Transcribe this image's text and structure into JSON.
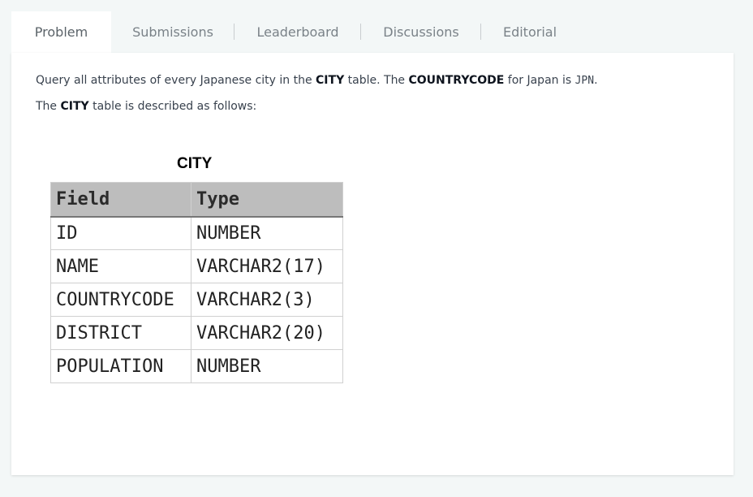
{
  "tabs": [
    {
      "label": "Problem",
      "active": true
    },
    {
      "label": "Submissions"
    },
    {
      "label": "Leaderboard"
    },
    {
      "label": "Discussions"
    },
    {
      "label": "Editorial"
    }
  ],
  "problem": {
    "line1": {
      "t1": "Query all attributes of every Japanese city in the ",
      "b1": "CITY",
      "t2": " table. The ",
      "b2": "COUNTRYCODE",
      "t3": " for Japan is ",
      "code": "JPN",
      "t4": "."
    },
    "line2": {
      "t1": "The ",
      "b1": "CITY",
      "t2": " table is described as follows:"
    }
  },
  "table": {
    "caption": "CITY",
    "headers": [
      "Field",
      "Type"
    ],
    "rows": [
      [
        "ID",
        "NUMBER"
      ],
      [
        "NAME",
        "VARCHAR2(17)"
      ],
      [
        "COUNTRYCODE",
        "VARCHAR2(3)"
      ],
      [
        "DISTRICT",
        "VARCHAR2(20)"
      ],
      [
        "POPULATION",
        "NUMBER"
      ]
    ]
  }
}
